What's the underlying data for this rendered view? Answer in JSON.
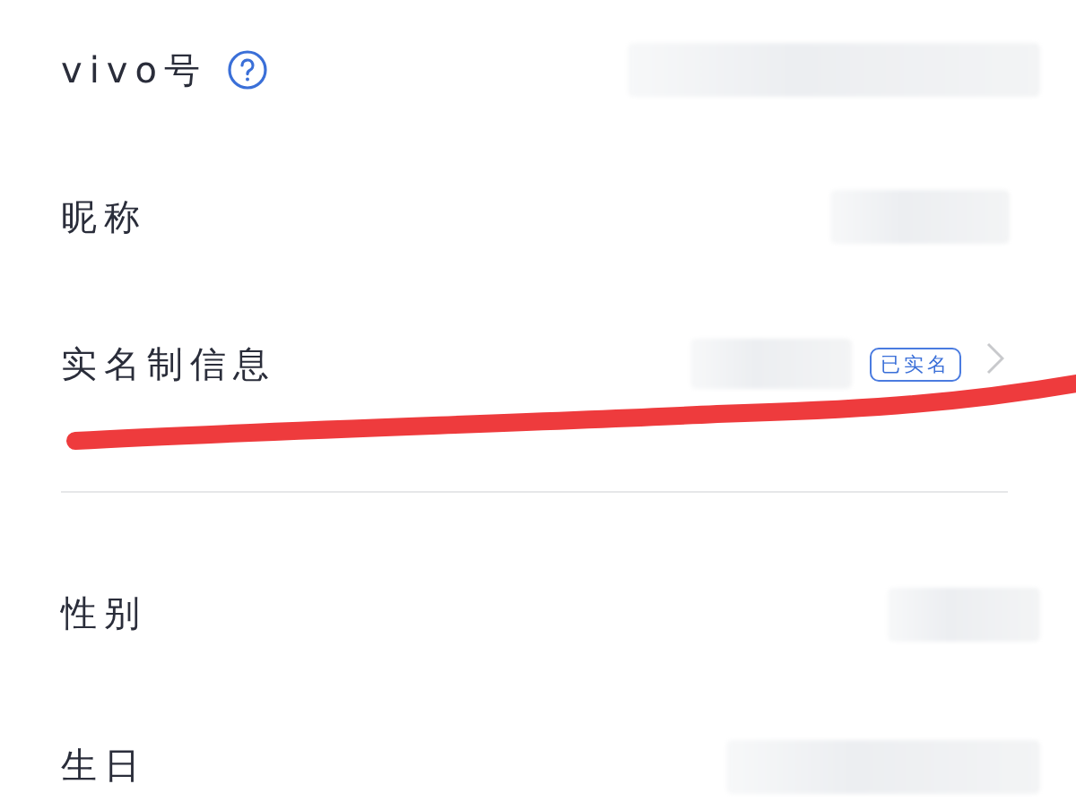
{
  "groups": [
    {
      "rows": [
        {
          "label": "vivo号",
          "help": true
        },
        {
          "label": "昵称"
        },
        {
          "label": "实名制信息",
          "badge": "已实名",
          "chevron": true
        }
      ]
    },
    {
      "rows": [
        {
          "label": "性别"
        },
        {
          "label": "生日"
        }
      ]
    }
  ],
  "annotation": {
    "kind": "stroke",
    "color": "#ee3b3d"
  }
}
